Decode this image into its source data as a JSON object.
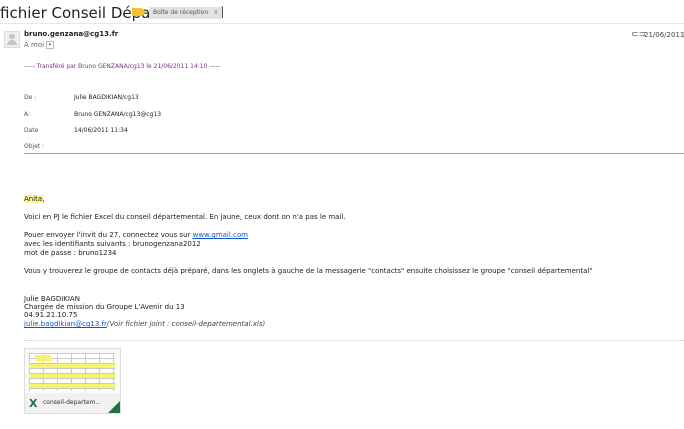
{
  "subject": "fichier Conseil Départemental",
  "label": "Boîte de réception",
  "label_close": "x",
  "sender": "bruno.genzana@cg13.fr",
  "to_me": "À moi",
  "to_me_toggle": "▾",
  "received_date": "21/06/2011",
  "more_menu": "⋮",
  "forwarded_line": "----- Transféré par Bruno GENZANA/cg13 le 21/06/2011 14:10 -----",
  "headers": {
    "from_label": "De :",
    "from_value": "Julie BAGDIKIAN/cg13",
    "to_label": "A:",
    "to_value": "Bruno GENZANA/cg13@cg13",
    "date_label": "Date",
    "date_value": "14/06/2011 11:34",
    "subject_label": "Objet :"
  },
  "body": {
    "greeting": "Anita,",
    "line1": "Voici en PJ le fichier Excel du conseil départemental. En jaune, ceux dont on n'a pas le mail.",
    "line2_pre": "Pouer envoyer l'invit du 27, connectez vous sur ",
    "line2_link": "www.gmail.com",
    "line3": "avec les identifiants suivants : brunogenzana2012",
    "line4": "mot de passe : bruno1234",
    "line5": "Vous y trouverez le groupe de contacts déjà préparé, dans les onglets à gauche de la messagerie \"contacts\" ensuite choisissez le groupe \"conseil départemental\""
  },
  "signature": {
    "name": "Julie BAGDIKIAN",
    "role": "Chargée de mission du Groupe L'Avenir du 13",
    "phone": "04.91.21.10.75",
    "email": "julie.bagdikian@cg13.fr",
    "attachment_note": "(Voir fichier joint : conseil-departemental.xls)"
  },
  "attachment": {
    "name": "conseil-departem...",
    "icon": "X",
    "type_color": "#1e7145"
  },
  "colors": {
    "highlight": "#f9f79a",
    "link": "#1155cc",
    "forward": "#7b3085",
    "important": "#f2c233"
  }
}
